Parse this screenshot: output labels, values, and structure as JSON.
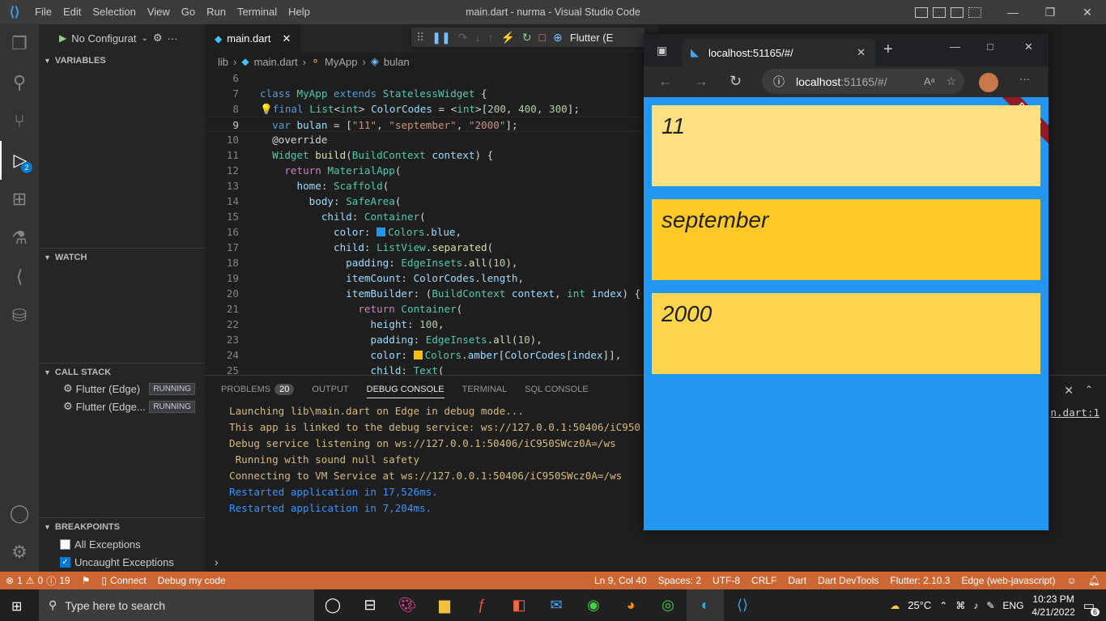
{
  "window": {
    "title": "main.dart - nurma - Visual Studio Code",
    "menu": [
      "File",
      "Edit",
      "Selection",
      "View",
      "Go",
      "Run",
      "Terminal",
      "Help"
    ]
  },
  "debug_sidebar": {
    "config_label": "No Configurat",
    "variables_label": "VARIABLES",
    "watch_label": "WATCH",
    "call_stack_label": "CALL STACK",
    "call_stack": [
      {
        "name": "Flutter (Edge)",
        "status": "RUNNING"
      },
      {
        "name": "Flutter (Edge...",
        "status": "RUNNING"
      }
    ],
    "breakpoints_label": "BREAKPOINTS",
    "breakpoints": [
      {
        "label": "All Exceptions",
        "checked": false
      },
      {
        "label": "Uncaught Exceptions",
        "checked": true
      }
    ]
  },
  "activity_badge": "2",
  "editor": {
    "tab_label": "main.dart",
    "breadcrumb": [
      "lib",
      "main.dart",
      "MyApp",
      "bulan"
    ],
    "debug_target": "Flutter (E"
  },
  "code_lines": [
    {
      "n": "6",
      "html": ""
    },
    {
      "n": "7",
      "html": "<span class='k'>class</span> <span class='t'>MyApp</span> <span class='k'>extends</span> <span class='t'>StatelessWidget</span> <span class='w'>{</span>"
    },
    {
      "n": "8",
      "html": "<span style='color:#ffcc00'>💡</span><span class='k'>final</span> <span class='t'>List</span><span class='w'>&lt;</span><span class='t'>int</span><span class='w'>&gt;</span> <span class='p'>ColorCodes</span> <span class='w'>= &lt;</span><span class='t'>int</span><span class='w'>&gt;[</span><span class='n'>200</span><span class='w'>, </span><span class='n'>400</span><span class='w'>, </span><span class='n'>300</span><span class='w'>];</span>"
    },
    {
      "n": "9",
      "html": "  <span class='k'>var</span> <span class='p'>bulan</span> <span class='w'>= [</span><span class='s'>\"11\"</span><span class='w'>, </span><span class='s'>\"september\"</span><span class='w'>, </span><span class='s'>\"2000\"</span><span class='w'>];</span>",
      "current": true
    },
    {
      "n": "10",
      "html": "  <span class='w'>@override</span>"
    },
    {
      "n": "11",
      "html": "  <span class='t'>Widget</span> <span class='f'>build</span><span class='w'>(</span><span class='t'>BuildContext</span> <span class='p'>context</span><span class='w'>) {</span>"
    },
    {
      "n": "12",
      "html": "    <span class='c'>return</span> <span class='t'>MaterialApp</span><span class='w'>(</span>"
    },
    {
      "n": "13",
      "html": "      <span class='p'>home</span><span class='w'>: </span><span class='t'>Scaffold</span><span class='w'>(</span>"
    },
    {
      "n": "14",
      "html": "        <span class='p'>body</span><span class='w'>: </span><span class='t'>SafeArea</span><span class='w'>(</span>"
    },
    {
      "n": "15",
      "html": "          <span class='p'>child</span><span class='w'>: </span><span class='t'>Container</span><span class='w'>(</span>"
    },
    {
      "n": "16",
      "html": "            <span class='p'>color</span><span class='w'>: </span><span class='sq' style='background:#2196f3'></span><span class='t'>Colors</span><span class='w'>.</span><span class='p'>blue</span><span class='w'>,</span>"
    },
    {
      "n": "17",
      "html": "            <span class='p'>child</span><span class='w'>: </span><span class='t'>ListView</span><span class='w'>.</span><span class='f'>separated</span><span class='w'>(</span>"
    },
    {
      "n": "18",
      "html": "              <span class='p'>padding</span><span class='w'>: </span><span class='t'>EdgeInsets</span><span class='w'>.</span><span class='f'>all</span><span class='w'>(</span><span class='n'>10</span><span class='w'>),</span>"
    },
    {
      "n": "19",
      "html": "              <span class='p'>itemCount</span><span class='w'>: </span><span class='p'>ColorCodes</span><span class='w'>.</span><span class='p'>length</span><span class='w'>,</span>"
    },
    {
      "n": "20",
      "html": "              <span class='p'>itemBuilder</span><span class='w'>: (</span><span class='t'>BuildContext</span> <span class='p'>context</span><span class='w'>, </span><span class='t'>int</span> <span class='p'>index</span><span class='w'>) {</span>"
    },
    {
      "n": "21",
      "html": "                <span class='c'>return</span> <span class='t'>Container</span><span class='w'>(</span>"
    },
    {
      "n": "22",
      "html": "                  <span class='p'>height</span><span class='w'>: </span><span class='n'>100</span><span class='w'>,</span>"
    },
    {
      "n": "23",
      "html": "                  <span class='p'>padding</span><span class='w'>: </span><span class='t'>EdgeInsets</span><span class='w'>.</span><span class='f'>all</span><span class='w'>(</span><span class='n'>10</span><span class='w'>),</span>"
    },
    {
      "n": "24",
      "html": "                  <span class='p'>color</span><span class='w'>: </span><span class='sq' style='background:#ffc107'></span><span class='t'>Colors</span><span class='w'>.</span><span class='p'>amber</span><span class='w'>[</span><span class='p'>ColorCodes</span><span class='w'>[</span><span class='p'>index</span><span class='w'>]],</span>"
    },
    {
      "n": "25",
      "html": "                  <span class='p'>child</span><span class='w'>: </span><span class='t'>Text</span><span class='w'>(</span>"
    }
  ],
  "panel": {
    "tabs": [
      "PROBLEMS",
      "OUTPUT",
      "DEBUG CONSOLE",
      "TERMINAL",
      "SQL CONSOLE"
    ],
    "problems_count": "20",
    "console_lines": [
      {
        "text": "Launching lib\\main.dart on Edge in debug mode...",
        "color": "#d7ba7d"
      },
      {
        "text": "This app is linked to the debug service: ws://127.0.0.1:50406/iC950",
        "color": "#d7ba7d"
      },
      {
        "text": "Debug service listening on ws://127.0.0.1:50406/iC950SWcz0A=/ws",
        "color": "#d7ba7d"
      },
      {
        "text": " Running with sound null safety",
        "color": "#d7ba7d"
      },
      {
        "text": "Connecting to VM Service at ws://127.0.0.1:50406/iC950SWcz0A=/ws",
        "color": "#d7ba7d"
      },
      {
        "text": "Restarted application in 17,526ms.",
        "color": "#3794ff"
      },
      {
        "text": "Restarted application in 7,204ms.",
        "color": "#3794ff"
      }
    ],
    "source_link": "n.dart:1"
  },
  "statusbar": {
    "errors": "1",
    "warnings": "0",
    "infos": "19",
    "connect": "Connect",
    "debug_label": "Debug my code",
    "position": "Ln 9, Col 40",
    "spaces": "Spaces: 2",
    "encoding": "UTF-8",
    "eol": "CRLF",
    "language": "Dart",
    "devtools": "Dart DevTools",
    "flutter": "Flutter: 2.10.3",
    "device": "Edge (web-javascript)",
    "color": "#cc6633"
  },
  "browser": {
    "tab_title": "localhost:51165/#/",
    "address_host": "localhost",
    "address_rest": ":51165/#/",
    "debug_banner": "DEBUG",
    "items": [
      {
        "text": "11",
        "color": "#ffe082"
      },
      {
        "text": "september",
        "color": "#ffca28"
      },
      {
        "text": "2000",
        "color": "#ffd54f"
      }
    ]
  },
  "taskbar": {
    "search_placeholder": "Type here to search",
    "temperature": "25°C",
    "language": "ENG",
    "time": "10:23 PM",
    "date": "4/21/2022",
    "notifications": "6"
  }
}
